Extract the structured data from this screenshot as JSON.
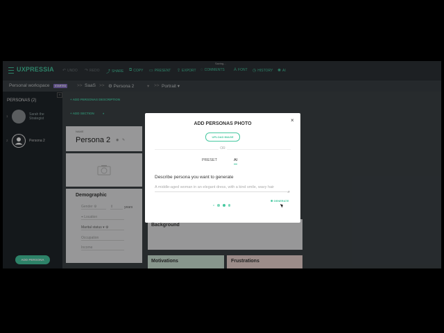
{
  "app": {
    "logo": "UXPRESSIA",
    "saving": "Saving..."
  },
  "toolbar": [
    {
      "name": "undo",
      "label": "UNDO",
      "icon": "↶",
      "disabled": true
    },
    {
      "name": "redo",
      "label": "REDO",
      "icon": "↷",
      "disabled": true
    },
    {
      "name": "share",
      "label": "SHARE",
      "icon": "⤴",
      "disabled": false
    },
    {
      "name": "copy",
      "label": "COPY",
      "icon": "⧉",
      "disabled": false
    },
    {
      "name": "present",
      "label": "PRESENT",
      "icon": "▭",
      "disabled": false
    },
    {
      "name": "export",
      "label": "EXPORT",
      "icon": "⇪",
      "disabled": false
    },
    {
      "name": "comments",
      "label": "COMMENTS",
      "icon": "◌",
      "disabled": false
    },
    {
      "name": "font",
      "label": "FONT",
      "icon": "A",
      "disabled": false
    },
    {
      "name": "history",
      "label": "HISTORY",
      "icon": "◷",
      "disabled": false
    },
    {
      "name": "ai",
      "label": "AI",
      "icon": "✺",
      "disabled": false
    }
  ],
  "breadcrumb": {
    "workspace": "Personal workspace",
    "badge": "STARTED",
    "sep": ">>",
    "project": "SaaS",
    "persona": "Persona 2",
    "view": "Portrait"
  },
  "sidebar": {
    "title": "PERSONAS (2)",
    "personas": [
      {
        "num": "1",
        "name": "Sarah the Strategist"
      },
      {
        "num": "2",
        "name": "Persona 2"
      }
    ],
    "add_button": "ADD PERSONA"
  },
  "main": {
    "add_description": "+ ADD PERSONAS DESCRIPTION",
    "add_section": "+ ADD SECTION",
    "name_label": "NAME",
    "persona_name": "Persona 2",
    "demographic": {
      "title": "Demographic",
      "gender": "Gender",
      "age_unit": "years",
      "location": "Location",
      "marital": "Marital status",
      "occupation": "Occupation",
      "income": "Income"
    },
    "background": "Background",
    "motivations": "Motivations",
    "frustrations": "Frustrations"
  },
  "modal": {
    "title": "ADD PERSONAS PHOTO",
    "upload": "UPLOAD IMAGE",
    "or": "OR",
    "tab_preset": "PRESET",
    "tab_ai": "AI",
    "label": "Describe persona you want to generate",
    "placeholder": "A middle-aged woman in an elegant dress, with a kind smile, wavy hair",
    "generate": "GENERATE",
    "close": "×"
  },
  "colors": {
    "accent": "#46c8a0",
    "badge": "#8a74c8",
    "motivations": "#cfe6d8",
    "frustrations": "#f0d8d3"
  }
}
